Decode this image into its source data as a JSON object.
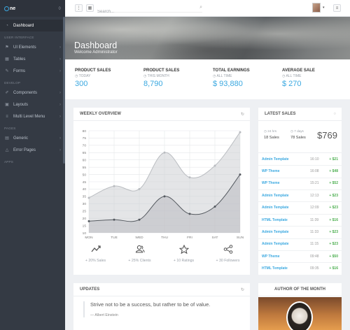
{
  "brand": {
    "logo_text": "ne",
    "toggle_icon": "double-chevron-icon"
  },
  "sidebar": {
    "dashboard": "Dashboard",
    "sections": {
      "ui": "USER INTERFACE",
      "develop": "DEVELOP",
      "pages": "PAGES",
      "apps": "APPS"
    },
    "ui_items": [
      "UI Elements",
      "Tables",
      "Forms"
    ],
    "develop_items": [
      "Components",
      "Layouts",
      "Multi Level Menu"
    ],
    "pages_items": [
      "Generic",
      "Error Pages"
    ]
  },
  "topbar": {
    "search_placeholder": "Search..."
  },
  "header": {
    "title": "Dashboard",
    "subtitle": "Welcome Administrator"
  },
  "stats": [
    {
      "label": "PRODUCT SALES",
      "period": "TODAY",
      "value": "300"
    },
    {
      "label": "PRODUCT SALES",
      "period": "THIS MONTH",
      "value": "8,790"
    },
    {
      "label": "TOTAL EARNINGS",
      "period": "ALL TIME",
      "value": "$ 93,880"
    },
    {
      "label": "AVERAGE SALE",
      "period": "ALL TIME",
      "value": "$ 270"
    }
  ],
  "weekly": {
    "title": "WEEKLY OVERVIEW",
    "icons": [
      {
        "icon": "trend-line-icon",
        "text": "+ 20% Sales"
      },
      {
        "icon": "users-icon",
        "text": "+ 25% Clients"
      },
      {
        "icon": "star-icon",
        "text": "+ 10 Ratings"
      },
      {
        "icon": "share-icon",
        "text": "+ 30 Followers"
      }
    ]
  },
  "chart_data": {
    "type": "area",
    "categories": [
      "MON",
      "TUE",
      "WED",
      "THU",
      "FRI",
      "SAT",
      "SUN"
    ],
    "ylim": [
      10,
      80
    ],
    "yticks": [
      10,
      15,
      20,
      25,
      30,
      35,
      40,
      45,
      50,
      55,
      60,
      65,
      70,
      75,
      80
    ],
    "series": [
      {
        "values": [
          34,
          42,
          40,
          65,
          48,
          56,
          79
        ],
        "color": "#b9bcc0"
      },
      {
        "values": [
          18,
          19,
          19,
          35,
          23,
          28,
          50
        ],
        "color": "#555a60"
      }
    ],
    "grid": true
  },
  "latest": {
    "title": "LATEST SALES",
    "sum": [
      {
        "period": "24 hrs",
        "value": "18 Sales"
      },
      {
        "period": "7 days",
        "value": "78 Sales"
      }
    ],
    "total": "$769",
    "rows": [
      {
        "name": "Admin Template",
        "time": "16:10",
        "amount": "+ $21"
      },
      {
        "name": "WP Theme",
        "time": "16:08",
        "amount": "+ $48"
      },
      {
        "name": "WP Theme",
        "time": "15:21",
        "amount": "+ $52"
      },
      {
        "name": "Admin Template",
        "time": "12:13",
        "amount": "+ $23"
      },
      {
        "name": "Admin Template",
        "time": "12:09",
        "amount": "+ $23"
      },
      {
        "name": "HTML Template",
        "time": "11:39",
        "amount": "+ $16"
      },
      {
        "name": "Admin Template",
        "time": "11:33",
        "amount": "+ $23"
      },
      {
        "name": "Admin Template",
        "time": "11:15",
        "amount": "+ $23"
      },
      {
        "name": "WP Theme",
        "time": "09:48",
        "amount": "+ $50"
      },
      {
        "name": "HTML Template",
        "time": "09:35",
        "amount": "+ $16"
      }
    ]
  },
  "updates": {
    "title": "UPDATES",
    "quote": "Strive not to be a success, but rather to be of value.",
    "author": "— Albert Einstein"
  },
  "author_month": {
    "title": "AUTHOR OF THE MONTH"
  },
  "colors": {
    "accent": "#3aa8e0",
    "sidebar": "#343a44",
    "positive": "#4caf50"
  }
}
